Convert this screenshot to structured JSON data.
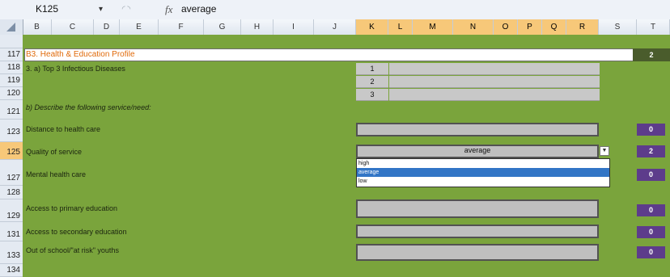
{
  "formula_bar": {
    "name_box": "K125",
    "fx_label": "fx",
    "value": "average"
  },
  "columns": [
    "B",
    "C",
    "D",
    "E",
    "F",
    "G",
    "H",
    "I",
    "J",
    "K",
    "L",
    "M",
    "N",
    "O",
    "P",
    "Q",
    "R",
    "S",
    "T"
  ],
  "selected_column": "K",
  "rows": [
    "117",
    "118",
    "119",
    "120",
    "121",
    "123",
    "125",
    "127",
    "128",
    "129",
    "131",
    "133",
    "134"
  ],
  "selected_row": "125",
  "section": {
    "title": "B3. Health & Education Profile",
    "score": "2"
  },
  "q3a": {
    "label": "3. a) Top 3 Infectious Diseases",
    "numbers": [
      "1",
      "2",
      "3"
    ]
  },
  "q3b_label": "b) Describe the following service/need:",
  "items": [
    {
      "label": "Distance to health care",
      "value": "",
      "score": "0"
    },
    {
      "label": "Quality of service",
      "value": "average",
      "score": "2"
    },
    {
      "label": "Mental health care",
      "value": "",
      "score": "0"
    },
    {
      "label": "Access to primary education",
      "value": "",
      "score": "0"
    },
    {
      "label": "Access to secondary education",
      "value": "",
      "score": "0"
    },
    {
      "label": "Out of school/\"at risk\" youths",
      "value": "",
      "score": "0"
    }
  ],
  "dropdown": {
    "options": [
      "high",
      "average",
      "low"
    ],
    "selected": "average"
  },
  "colors": {
    "sheet_green": "#7aa43c",
    "title_orange": "#e06a0a",
    "badge_purple": "#5d3c8b",
    "selected_header": "#f7c879",
    "highlight_blue": "#3275c6"
  }
}
